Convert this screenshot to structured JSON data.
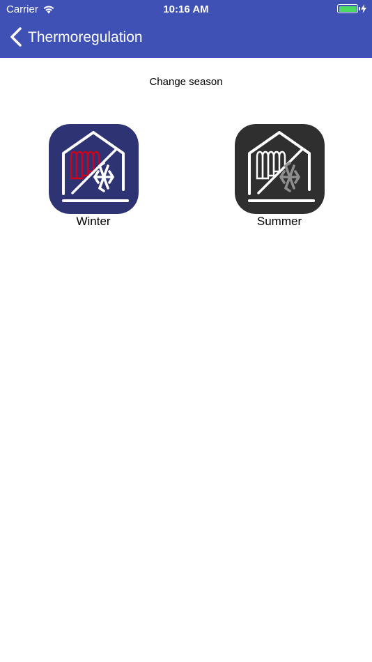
{
  "status_bar": {
    "carrier": "Carrier",
    "time": "10:16 AM",
    "icons": [
      "wifi-icon",
      "battery-icon",
      "charging-bolt-icon"
    ],
    "battery_level": 1.0,
    "battery_color": "#4cd964"
  },
  "nav": {
    "title": "Thermoregulation",
    "back_icon": "chevron-left-icon",
    "background_color": "#3f51b5"
  },
  "content": {
    "subtitle": "Change season"
  },
  "seasons": [
    {
      "label": "Winter",
      "icon": "house-radiator-snowflake-icon",
      "background": "#2e3374",
      "radiator_color": "#d0021b",
      "snowflake_color": "#ffffff"
    },
    {
      "label": "Summer",
      "icon": "house-radiator-snowflake-icon",
      "background": "#2f2f2f",
      "radiator_color": "#ffffff",
      "snowflake_color": "#8e8e8e"
    }
  ]
}
